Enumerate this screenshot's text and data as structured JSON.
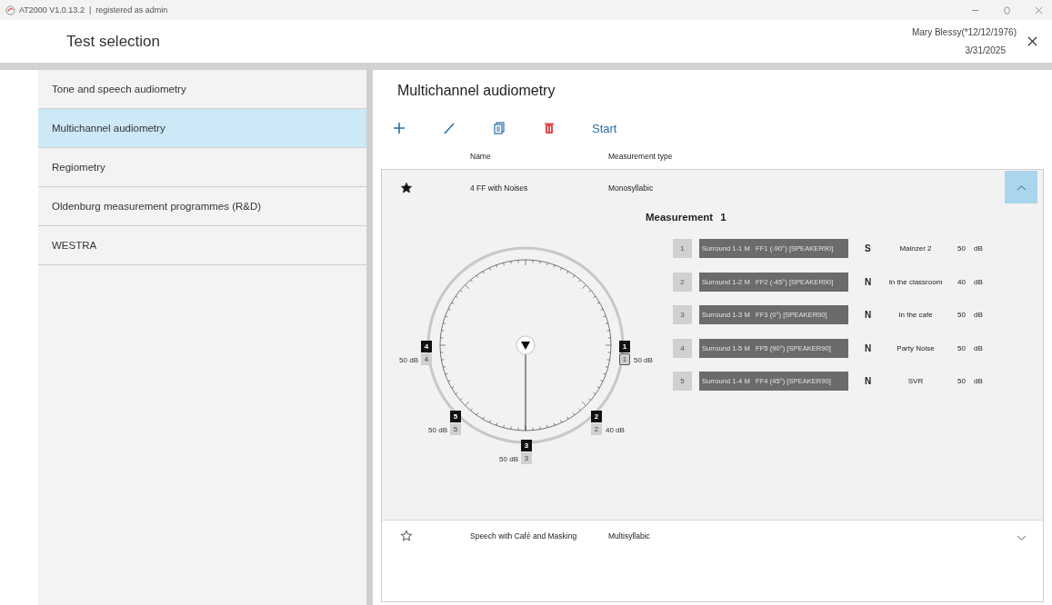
{
  "titlebar": {
    "title": "AT2000 V1.0.13.2  |  registered as admin"
  },
  "header": {
    "title": "Test selection",
    "patient": "Mary Blessy(*12/12/1976)",
    "date": "3/31/2025"
  },
  "sidebar": {
    "items": [
      {
        "label": "Tone and speech audiometry",
        "selected": false
      },
      {
        "label": "Multichannel audiometry",
        "selected": true
      },
      {
        "label": "Regiometry",
        "selected": false
      },
      {
        "label": "Oldenburg measurement programmes (R&D)",
        "selected": false
      },
      {
        "label": "WESTRA",
        "selected": false
      }
    ]
  },
  "main": {
    "title": "Multichannel audiometry",
    "toolbar": {
      "start": "Start"
    },
    "columns": [
      "Name",
      "Measurement type"
    ],
    "programs": [
      {
        "name": "4 FF with Noises",
        "type": "Monosyllabic",
        "favorite": true,
        "expanded": true,
        "measurement": {
          "title": "Measurement 1",
          "speakers": [
            {
              "marker": "1",
              "channel": "1",
              "reading": "50 dB",
              "selected": true
            },
            {
              "marker": "2",
              "channel": "2",
              "reading": "40 dB",
              "selected": false
            },
            {
              "marker": "3",
              "channel": "3",
              "reading": "50 dB",
              "selected": false
            },
            {
              "marker": "4",
              "channel": "4",
              "reading": "50 dB",
              "selected": false
            },
            {
              "marker": "5",
              "channel": "5",
              "reading": "50 dB",
              "selected": false
            }
          ],
          "channels": [
            {
              "number": "1",
              "output": "Surround 1-1 M   FF1 (-90°) [SPEAKER90]",
              "role": "S",
              "signal": "Mainzer 2",
              "value": "50",
              "unit": "dB"
            },
            {
              "number": "2",
              "output": "Surround 1-2 M   FF2 (-45°) [SPEAKER90]",
              "role": "N",
              "signal": "In the classroom",
              "value": "40",
              "unit": "dB"
            },
            {
              "number": "3",
              "output": "Surround 1-3 M   FF3 (0°) [SPEAKER90]",
              "role": "N",
              "signal": "In the cafe",
              "value": "50",
              "unit": "dB"
            },
            {
              "number": "4",
              "output": "Surround 1-5 M   FF5 (90°) [SPEAKER90]",
              "role": "N",
              "signal": "Party Noise",
              "value": "50",
              "unit": "dB"
            },
            {
              "number": "5",
              "output": "Surround 1-4 M   FF4 (45°) [SPEAKER90]",
              "role": "N",
              "signal": "SVR",
              "value": "50",
              "unit": "dB"
            }
          ]
        }
      },
      {
        "name": "Speech with Café and Masking",
        "type": "Multisyllabic",
        "favorite": false,
        "expanded": false
      }
    ]
  }
}
